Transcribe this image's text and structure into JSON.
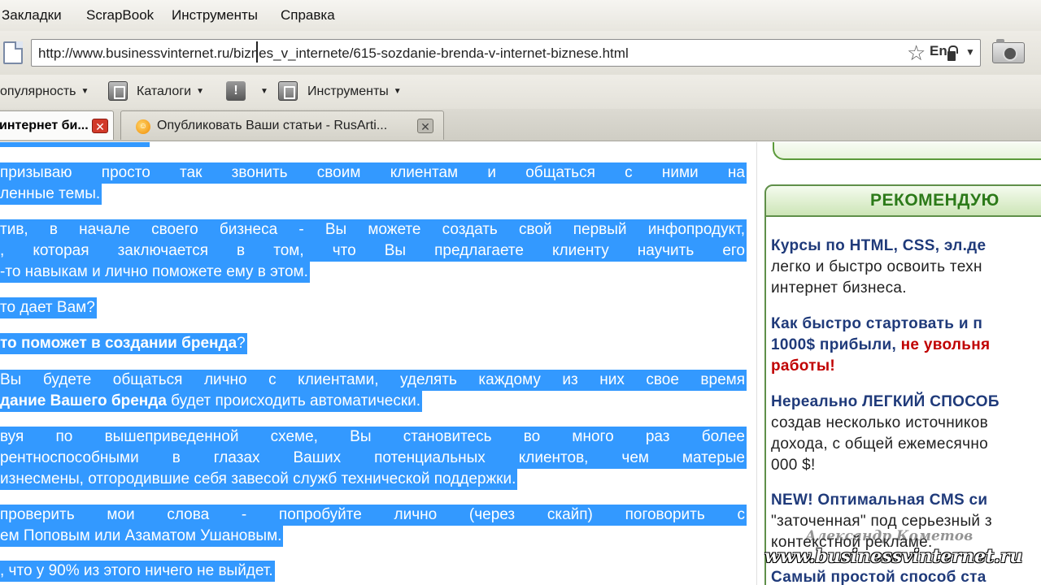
{
  "menu": {
    "items": [
      "Закладки",
      "ScrapBook",
      "Инструменты",
      "Справка"
    ]
  },
  "nav": {
    "url": "http://www.businessvinternet.ru/biznes_v_internete/615-sozdanie-brenda-v-internet-biznese.html",
    "lang": "En"
  },
  "toolbar": {
    "popularity": "опулярность",
    "catalogs": "Каталоги",
    "alert": "!",
    "tools": "Инструменты"
  },
  "tabs": {
    "active": "интернет би...",
    "inactive": "Опубликовать Ваши статьи - RusArti..."
  },
  "article": {
    "l1": "призываю просто так звонить своим клиентам и общаться с ними на",
    "l2": "ленные темы.",
    "l3": "тив, в начале своего бизнеса - Вы можете создать свой первый инфопродукт,",
    "l4": ", которая заключается в том, что Вы предлагаете клиенту научить его",
    "l5": "-то навыкам и лично поможете ему в этом.",
    "l6": "то дает Вам?",
    "l7_bold": "то поможет в создании бренда",
    "l7_rest": "?",
    "l8": "Вы будете общаться лично с клиентами, уделять каждому из них свое время",
    "l9_bold": "дание Вашего бренда",
    "l9_rest": " будет происходить автоматически.",
    "l10": "вуя по вышеприведенной схеме, Вы становитесь во много раз более",
    "l11": "рентноспособными в глазах Ваших потенциальных клиентов, чем матерые",
    "l12": "изнесмены, отгородившие себя завесой служб технической поддержки.",
    "l13": "проверить мои слова - попробуйте лично (через скайп) поговорить с",
    "l14": "ем Поповым или Азаматом Ушановым.",
    "l15": ", что у 90% из этого ничего не выйдет."
  },
  "sidebar": {
    "title": "РЕКОМЕНДУЮ",
    "s1": "Курсы по HTML, CSS, эл.де",
    "s2": "легко и быстро освоить техн",
    "s3": "интернет бизнеса.",
    "s4": "Как быстро стартовать и п",
    "s5_a": "1000$ прибыли, ",
    "s5_red": "не увольня",
    "s6_red": "работы!",
    "s7": "Нереально ЛЕГКИЙ СПОСОБ",
    "s8": "создав несколько источников",
    "s9": "дохода, с общей ежемесячно",
    "s10": "000 $!",
    "s11": "NEW! Оптимальная CMS си",
    "s12": "\"заточенная\" под серьезный з",
    "s13": "контекстной рекламе.",
    "s14": "Самый простой способ ста"
  },
  "watermark": {
    "author": "Александр Кометов",
    "site": "www.businessvinternet.ru"
  }
}
